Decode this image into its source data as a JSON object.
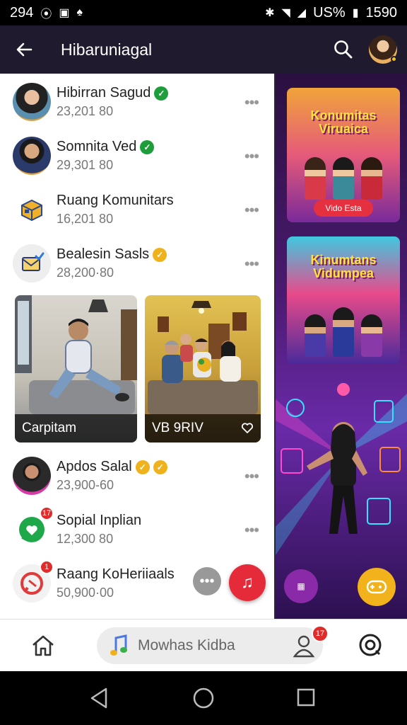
{
  "status_bar": {
    "time": "294",
    "signal_text": "US%",
    "battery": "1590"
  },
  "app_bar": {
    "title": "Hibaruniagal"
  },
  "list": [
    {
      "title": "Hibirran Sagud",
      "subtitle": "23,201 80",
      "badge": "green"
    },
    {
      "title": "Somnita Ved",
      "subtitle": "29,301 80",
      "badge": "green"
    },
    {
      "title": "Ruang Komunitars",
      "subtitle": "16,201 80",
      "badge": ""
    },
    {
      "title": "Bealesin Sasls",
      "subtitle": "28,200·80",
      "badge": "gold"
    },
    {
      "title": "Apdos Salal",
      "subtitle": "23,900-60",
      "badge": "gold-double"
    },
    {
      "title": "Sopial Inplian",
      "subtitle": "12,300 80",
      "badge": "",
      "notif": "17"
    },
    {
      "title": "Raang KoHeriiaals",
      "subtitle": "50,900·00",
      "badge": "",
      "notif": "1"
    }
  ],
  "cards": [
    {
      "caption": "Carpitam"
    },
    {
      "caption": "VB 9RIV"
    }
  ],
  "promo": [
    {
      "title": "Konumitas Viruaica",
      "button": "Vido Esta"
    },
    {
      "title": "Kinumtans Vidumpea"
    }
  ],
  "bottom_nav": {
    "player_label": "Mowhas Kidba",
    "profile_badge": "17"
  },
  "colors": {
    "app_bar": "#1f1a2e",
    "accent_red": "#e52b3a",
    "verified_green": "#1e9e3a",
    "gold": "#f0b21b"
  }
}
